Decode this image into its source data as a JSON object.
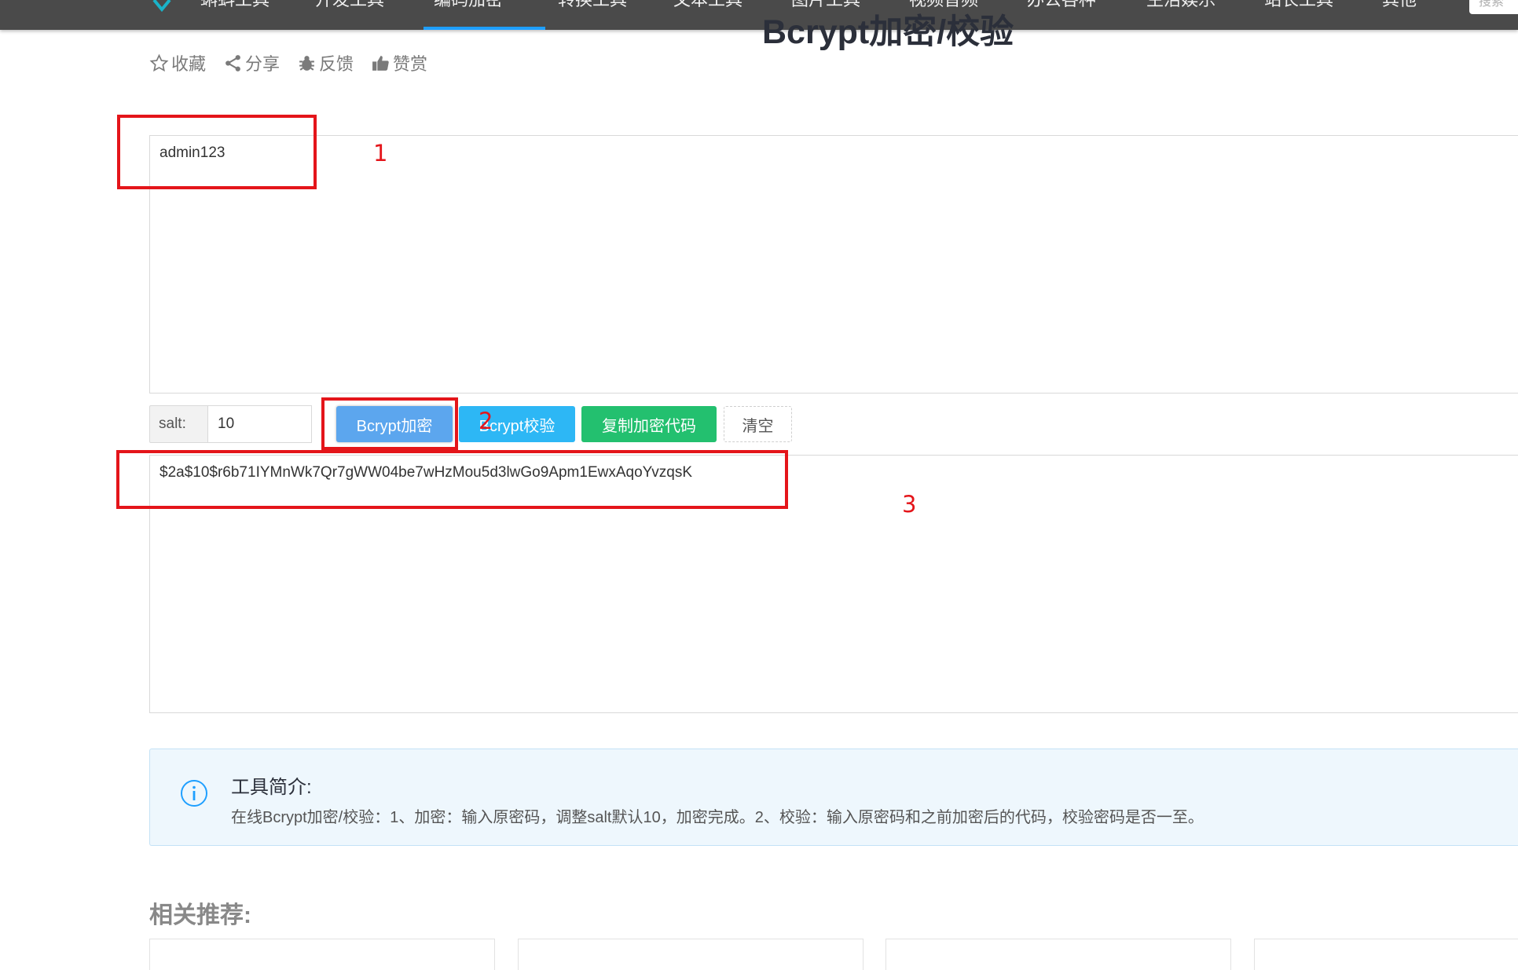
{
  "nav": {
    "items": [
      "蝌蚪工具",
      "开发工具",
      "编码加密",
      "转换工具",
      "文本工具",
      "图片工具",
      "视频音频",
      "办公各种",
      "生活娱乐",
      "站长工具",
      "其他"
    ],
    "search_placeholder": "搜索",
    "active_color": "#1e9fff"
  },
  "page": {
    "title": "Bcrypt加密/校验"
  },
  "actions": [
    {
      "icon": "star-icon",
      "label": "收藏"
    },
    {
      "icon": "share-icon",
      "label": "分享"
    },
    {
      "icon": "bug-icon",
      "label": "反馈"
    },
    {
      "icon": "thumbs-up-icon",
      "label": "赞赏"
    }
  ],
  "input": {
    "value": "admin123"
  },
  "salt": {
    "label": "salt:",
    "value": "10"
  },
  "buttons": {
    "encrypt": "Bcrypt加密",
    "verify": "Bcrypt校验",
    "copy": "复制加密代码",
    "clear": "清空"
  },
  "output": {
    "value": "$2a$10$r6b71IYMnWk7Qr7gWW04be7wHzMou5d3lwGo9Apm1EwxAqoYvzqsK"
  },
  "annotations": {
    "one": "1",
    "two": "2",
    "three": "3",
    "color": "#e4151a"
  },
  "intro": {
    "title": "工具简介:",
    "text": "在线Bcrypt加密/校验：1、加密：输入原密码，调整salt默认10，加密完成。2、校验：输入原密码和之前加密后的代码，校验密码是否一至。"
  },
  "related": {
    "title": "相关推荐:"
  }
}
